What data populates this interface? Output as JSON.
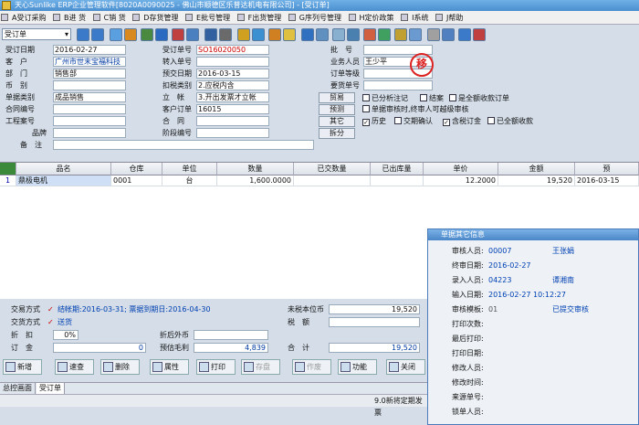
{
  "window": {
    "title": "天心Sunlike ERP企业管理软件[8020A0090025 - 佛山市顺德区乐普达机电有限公司] - [受订单]"
  },
  "menu": [
    "A受订采购",
    "B进 货",
    "C销 货",
    "D存货管理",
    "E批号管理",
    "F出货管理",
    "G序列号管理",
    "H定价政策",
    "I系统",
    "J帮助"
  ],
  "doc_type": "受订单",
  "form": {
    "order_date_label": "受订日期",
    "order_date": "2016-02-27",
    "customer_label": "客　户",
    "customer": "广州市世末宝福科技",
    "dept_label": "部　门",
    "dept": "销售部",
    "currency_label": "币　别",
    "currency": "",
    "doc_category_label": "单据类别",
    "doc_category": "成品销售",
    "contract_label": "合同编号",
    "contract": "",
    "project_label": "工程案号",
    "project": "",
    "brand_label": "品牌",
    "brand": "",
    "remark_label": "备　注",
    "remark": "",
    "order_no_label": "受订单号",
    "order_no": "SO16020050",
    "transfer_label": "转入单号",
    "transfer": "",
    "pre_delivery_label": "预交日期",
    "pre_delivery": "2016-03-15",
    "tax_type_label": "扣税类别",
    "tax_type": "2.应税内含",
    "account_label": "立　帐",
    "account": "3.开出发票才立帐",
    "cust_order_label": "客户订单",
    "cust_order": "16015",
    "contract2_label": "合　同",
    "contract2": "",
    "phase_label": "阶段编号",
    "phase": "",
    "approval_label": "批　号",
    "approval": "",
    "salesman_label": "业务人员",
    "salesman": "王少平",
    "order_level_label": "订单等级",
    "order_level": "",
    "quote_label": "要货单号",
    "quote": "",
    "stamp": "移"
  },
  "side_buttons": [
    "贸易",
    "预测",
    "其它",
    "拆分"
  ],
  "checks": [
    {
      "label": "已分析注记",
      "checked": false
    },
    {
      "label": "结案",
      "checked": false
    },
    {
      "label": "是全额收款订单",
      "checked": false
    },
    {
      "label": "单据审核时,终审人可越级审核",
      "checked": false
    },
    {
      "label": "历史",
      "checked": true
    },
    {
      "label": "交期确认",
      "checked": false
    },
    {
      "label": "含税订金",
      "checked": true
    },
    {
      "label": "已全额收款",
      "checked": false
    }
  ],
  "table": {
    "headers": [
      "品名",
      "仓库",
      "单位",
      "数量",
      "已交数量",
      "已出库量",
      "单价",
      "金额",
      "预"
    ],
    "rows": [
      {
        "idx": "1",
        "name": "鼎极电机",
        "warehouse": "0001",
        "unit": "台",
        "qty": "1,600.0000",
        "delivered": "",
        "out": "",
        "price": "12.2000",
        "amount": "19,520",
        "date": "2016-03-15"
      }
    ]
  },
  "popup": {
    "title": "单据其它信息",
    "rows": [
      {
        "label": "审核人员:",
        "value": "00007",
        "name": "王张娟"
      },
      {
        "label": "终审日期:",
        "value": "2016-02-27",
        "name": ""
      },
      {
        "label": "录入人员:",
        "value": "04223",
        "name": "谭湘南"
      },
      {
        "label": "输入日期:",
        "value": "2016-02-27  10:12:27",
        "name": ""
      },
      {
        "label": "审核模板:",
        "value": "01",
        "name": "已提交审核"
      },
      {
        "label": "打印次数:",
        "value": "",
        "name": ""
      },
      {
        "label": "最后打印:",
        "value": "",
        "name": ""
      },
      {
        "label": "打印日期:",
        "value": "",
        "name": ""
      },
      {
        "label": "修改人员:",
        "value": "",
        "name": ""
      },
      {
        "label": "修改时间:",
        "value": "",
        "name": ""
      },
      {
        "label": "来源单号:",
        "value": "",
        "name": ""
      },
      {
        "label": "锁单人员:",
        "value": "",
        "name": ""
      }
    ]
  },
  "bottom": {
    "trade_label": "交易方式",
    "trade_value": "结帐期:2016-03-31; 票据到期日:2016-04-30",
    "delivery_label": "交货方式",
    "delivery_value": "送货",
    "discount_label": "折　扣",
    "discount": "0%",
    "deposit_label": "订　金",
    "deposit": "0",
    "uninvoiced_label": "未税本位币",
    "uninvoiced": "19,520",
    "tax_label": "税　额",
    "tax": "",
    "discount_fc_label": "折后外币",
    "discount_fc": "",
    "profit_label": "预估毛利",
    "profit": "4,839",
    "total_label": "合　计",
    "total": "19,520"
  },
  "buttons": [
    {
      "label": "新增",
      "enabled": true
    },
    {
      "label": "速查",
      "enabled": true
    },
    {
      "label": "删除",
      "enabled": true
    },
    {
      "label": "属性",
      "enabled": true
    },
    {
      "label": "打印",
      "enabled": true
    },
    {
      "label": "存盘",
      "enabled": false
    },
    {
      "label": "作废",
      "enabled": false
    },
    {
      "label": "功能",
      "enabled": true
    },
    {
      "label": "关闭",
      "enabled": true
    }
  ],
  "tabs": [
    "总控画面",
    "受订单"
  ],
  "status": "9.0新将定期发票"
}
